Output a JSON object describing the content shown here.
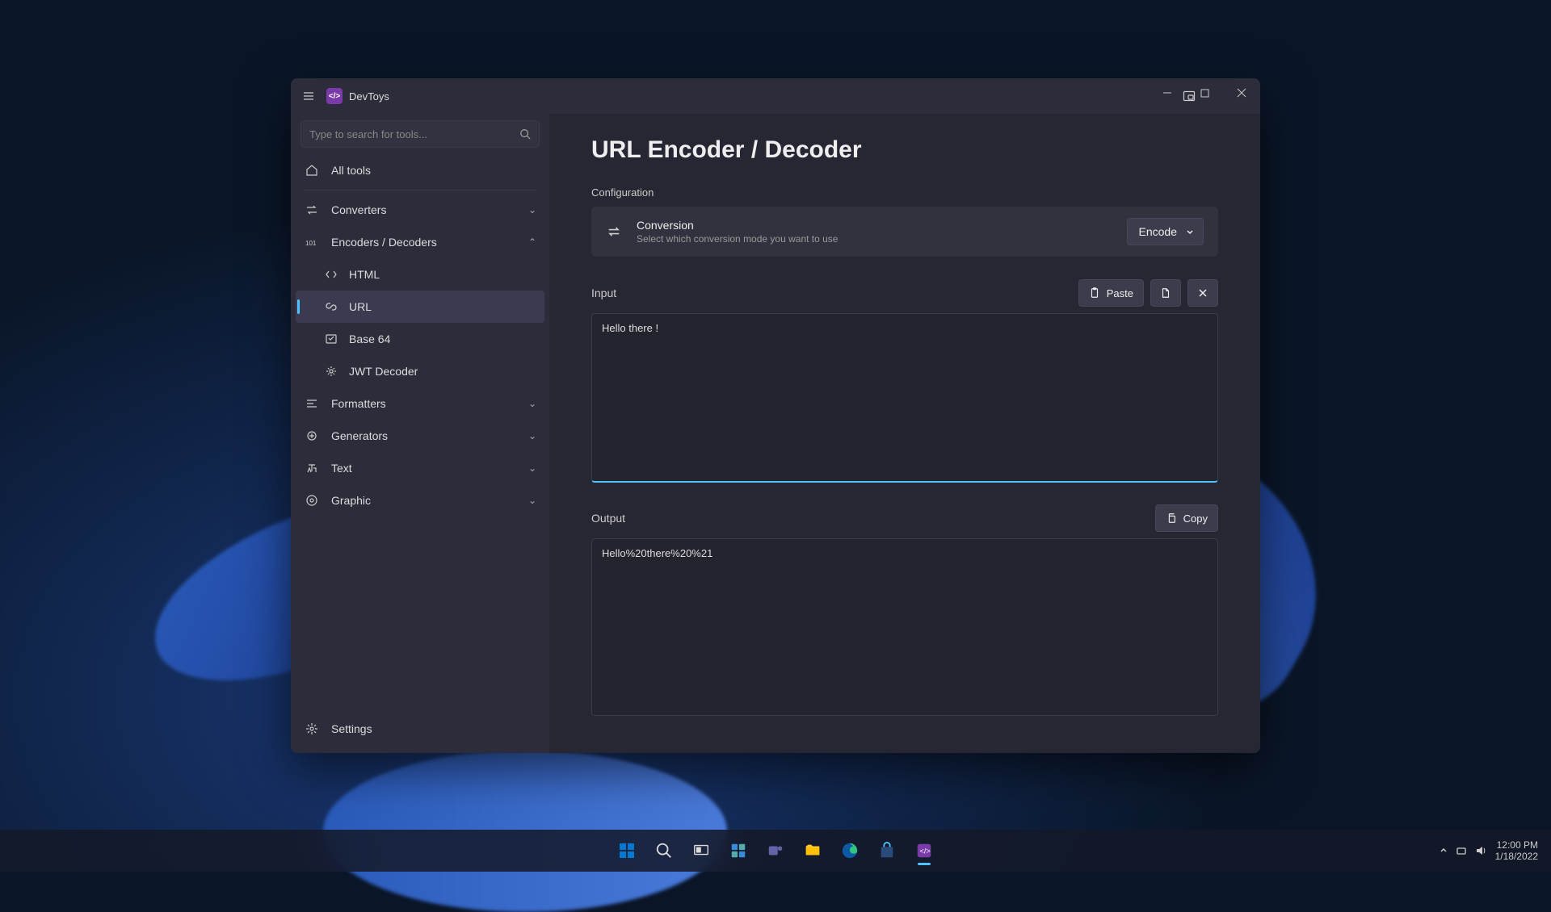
{
  "app": {
    "title": "DevToys"
  },
  "search": {
    "placeholder": "Type to search for tools..."
  },
  "sidebar": {
    "all_tools": "All tools",
    "converters": "Converters",
    "encoders": "Encoders / Decoders",
    "html": "HTML",
    "url": "URL",
    "base64": "Base 64",
    "jwt": "JWT Decoder",
    "formatters": "Formatters",
    "generators": "Generators",
    "text": "Text",
    "graphic": "Graphic",
    "settings": "Settings"
  },
  "page": {
    "title": "URL Encoder / Decoder",
    "config_label": "Configuration",
    "conversion_title": "Conversion",
    "conversion_desc": "Select which conversion mode you want to use",
    "mode": "Encode",
    "input_label": "Input",
    "paste": "Paste",
    "input_value": "Hello there !",
    "output_label": "Output",
    "copy": "Copy",
    "output_value": "Hello%20there%20%21"
  },
  "tray": {
    "time": "12:00 PM",
    "date": "1/18/2022"
  }
}
